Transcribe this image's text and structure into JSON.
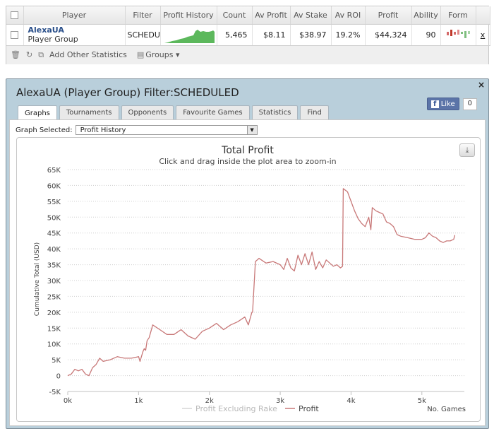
{
  "stats_table": {
    "headers": [
      "Player",
      "Filter",
      "Profit History",
      "Count",
      "Av Profit",
      "Av Stake",
      "Av ROI",
      "Profit",
      "Ability",
      "Form"
    ],
    "row": {
      "player_name": "AlexaUA",
      "player_sub": "Player Group",
      "filter": "SCHEDUL",
      "count": "5,465",
      "av_profit": "$8.11",
      "av_stake": "$38.97",
      "av_roi": "19.2%",
      "profit": "$44,324",
      "ability": "90",
      "remove": "x"
    },
    "toolbar": {
      "add_stats": "Add Other Statistics",
      "groups": "Groups ▾"
    }
  },
  "panel": {
    "title": "AlexaUA (Player Group) Filter:SCHEDULED",
    "close": "×",
    "like_label": "Like",
    "like_count": "0",
    "tabs": [
      "Graphs",
      "Tournaments",
      "Opponents",
      "Favourite Games",
      "Statistics",
      "Find"
    ],
    "active_tab": "Graphs",
    "graph_selected_label": "Graph Selected:",
    "graph_selected_value": "Profit History"
  },
  "colors": {
    "profit_line": "#c87878",
    "excl_rake_line": "#e6e6e6",
    "sparkline_fill": "#5cb85c",
    "panel_bg": "#b9cfdb",
    "link": "#2a4f8a"
  },
  "chart_data": {
    "type": "line",
    "title": "Total Profit",
    "subtitle": "Click and drag inside the plot area to zoom-in",
    "ylabel": "Cumulative Total (USD)",
    "xlabel": "No. Games",
    "ylim": [
      -5000,
      65000
    ],
    "xlim": [
      0,
      5600
    ],
    "yticks": [
      -5000,
      0,
      5000,
      10000,
      15000,
      20000,
      25000,
      30000,
      35000,
      40000,
      45000,
      50000,
      55000,
      60000,
      65000
    ],
    "ytick_labels": [
      "-5K",
      "0",
      "5K",
      "10K",
      "15K",
      "20K",
      "25K",
      "30K",
      "35K",
      "40K",
      "45K",
      "50K",
      "55K",
      "60K",
      "65K"
    ],
    "xticks": [
      0,
      1000,
      2000,
      3000,
      4000,
      5000
    ],
    "xtick_labels": [
      "0k",
      "1k",
      "2k",
      "3k",
      "4k",
      "5k"
    ],
    "grid": true,
    "legend_position": "bottom",
    "series": [
      {
        "name": "Profit Excluding Rake",
        "x": [],
        "y": []
      },
      {
        "name": "Profit",
        "x": [
          0,
          50,
          100,
          150,
          200,
          250,
          300,
          350,
          400,
          450,
          500,
          600,
          700,
          800,
          900,
          1000,
          1020,
          1060,
          1080,
          1100,
          1120,
          1150,
          1200,
          1300,
          1400,
          1500,
          1600,
          1700,
          1800,
          1900,
          2000,
          2100,
          2200,
          2300,
          2400,
          2500,
          2550,
          2600,
          2610,
          2650,
          2700,
          2800,
          2900,
          3000,
          3050,
          3100,
          3150,
          3200,
          3250,
          3300,
          3350,
          3400,
          3450,
          3500,
          3550,
          3600,
          3650,
          3700,
          3750,
          3800,
          3850,
          3880,
          3890,
          3920,
          3950,
          4000,
          4050,
          4100,
          4150,
          4200,
          4250,
          4280,
          4300,
          4350,
          4400,
          4450,
          4500,
          4550,
          4600,
          4650,
          4700,
          4800,
          4900,
          5000,
          5050,
          5100,
          5150,
          5200,
          5250,
          5300,
          5350,
          5400,
          5450,
          5465
        ],
        "y": [
          0,
          500,
          2000,
          1500,
          2000,
          500,
          0,
          2500,
          3500,
          5500,
          4500,
          5000,
          6000,
          5500,
          5500,
          6000,
          4500,
          7500,
          8500,
          8000,
          11000,
          12000,
          16000,
          14500,
          13000,
          13000,
          14500,
          12500,
          11500,
          14000,
          15000,
          16500,
          14500,
          16000,
          17000,
          18500,
          16000,
          20000,
          20000,
          36000,
          37000,
          35500,
          36000,
          35000,
          33500,
          37000,
          34000,
          33000,
          38000,
          35000,
          38500,
          35000,
          39000,
          33500,
          36000,
          34000,
          36500,
          35500,
          34500,
          35000,
          34000,
          34500,
          59000,
          58500,
          58000,
          55000,
          52000,
          49500,
          48000,
          47000,
          50000,
          46000,
          53000,
          52000,
          51500,
          51000,
          48500,
          48000,
          47000,
          44500,
          44000,
          43500,
          43000,
          43000,
          43500,
          45000,
          44000,
          43500,
          42500,
          42000,
          42500,
          42500,
          43000,
          44324
        ]
      }
    ]
  }
}
